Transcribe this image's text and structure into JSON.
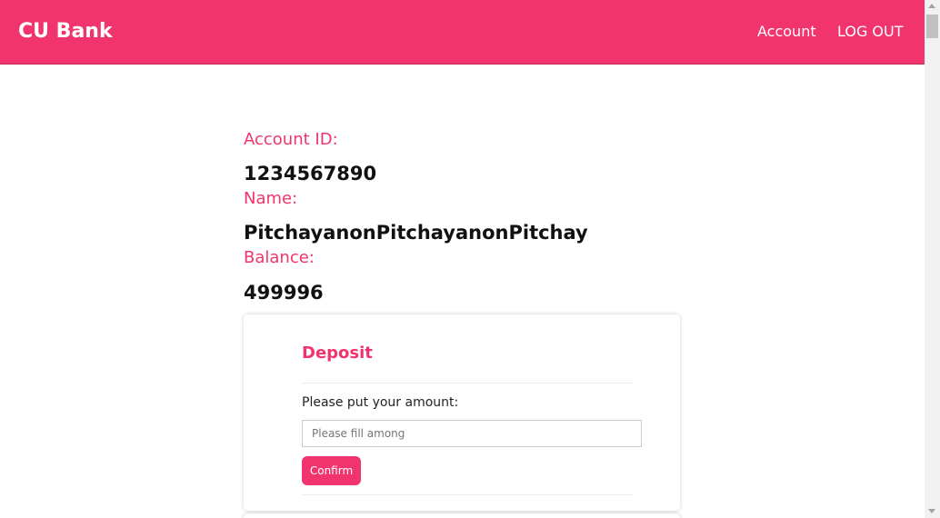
{
  "navbar": {
    "brand": "CU Bank",
    "links": [
      {
        "label": "Account"
      },
      {
        "label": "LOG OUT"
      }
    ]
  },
  "account": {
    "id_label": "Account ID:",
    "id_value": "1234567890",
    "name_label": "Name:",
    "name_value": "PitchayanonPitchayanonPitchay",
    "balance_label": "Balance:",
    "balance_value": "499996"
  },
  "deposit": {
    "title": "Deposit",
    "prompt": "Please put your amount:",
    "input_value": "",
    "input_placeholder": "Please fill among",
    "confirm_label": "Confirm"
  },
  "colors": {
    "accent": "#f1346d",
    "text": "#111111",
    "background": "#ffffff"
  }
}
